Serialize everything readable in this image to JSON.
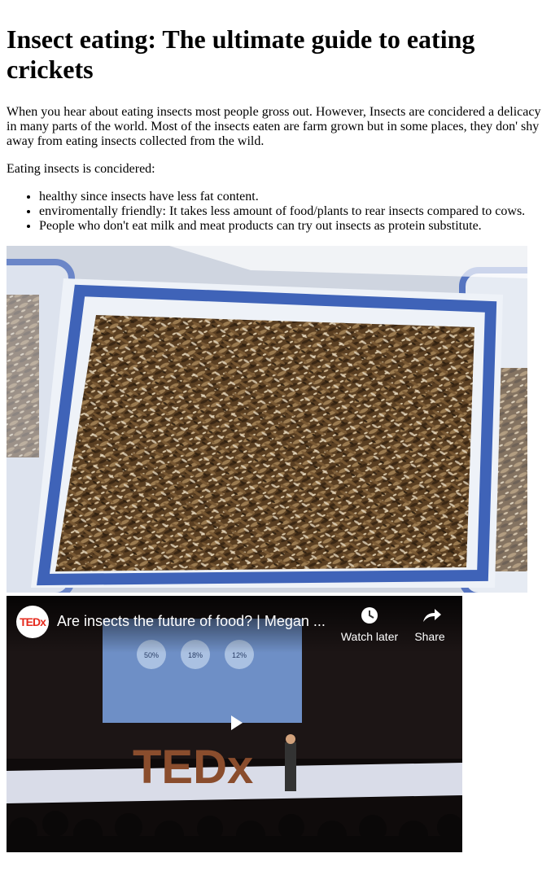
{
  "article": {
    "title": "Insect eating: The ultimate guide to eating crickets",
    "intro": "When you hear about eating insects most people gross out. However, Insects are concidered a delicacy in many parts of the world. Most of the insects eaten are farm grown but in some places, they don' shy away from eating insects collected from the wild.",
    "list_lead": "Eating insects is concidered:",
    "benefits": [
      "healthy since insects have less fat content.",
      "enviromentally friendly: It takes less amount of food/plants to rear insects compared to cows.",
      "People who don't eat milk and meat products can try out insects as protein substitute."
    ]
  },
  "video": {
    "channel_logo": "TEDx",
    "title": "Are insects the future of food? | Megan ...",
    "watch_later_label": "Watch later",
    "share_label": "Share",
    "stage_sign": "TEDx",
    "slide_stats": [
      "50%",
      "18%",
      "12%"
    ],
    "icons": {
      "watch_later": "clock-icon",
      "share": "share-arrow-icon",
      "play": "play-icon"
    }
  }
}
